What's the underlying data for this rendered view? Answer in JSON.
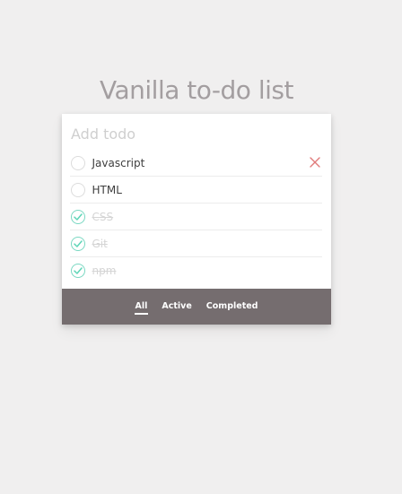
{
  "header": {
    "title": "Vanilla to-do list"
  },
  "input": {
    "placeholder": "Add todo",
    "value": ""
  },
  "todos": [
    {
      "label": "Javascript",
      "completed": false
    },
    {
      "label": "HTML",
      "completed": false
    },
    {
      "label": "CSS",
      "completed": true
    },
    {
      "label": "Git",
      "completed": true
    },
    {
      "label": "npm",
      "completed": true
    }
  ],
  "filters": [
    {
      "label": "All",
      "selected": true
    },
    {
      "label": "Active",
      "selected": false
    },
    {
      "label": "Completed",
      "selected": false
    }
  ],
  "colors": {
    "background": "#f0efef",
    "title": "#a39ea0",
    "footer": "#756d6f",
    "check": "#5dd5b7",
    "delete": "#e07a7a"
  },
  "icons": {
    "toggle": "check-circle-icon",
    "delete": "close-icon"
  }
}
